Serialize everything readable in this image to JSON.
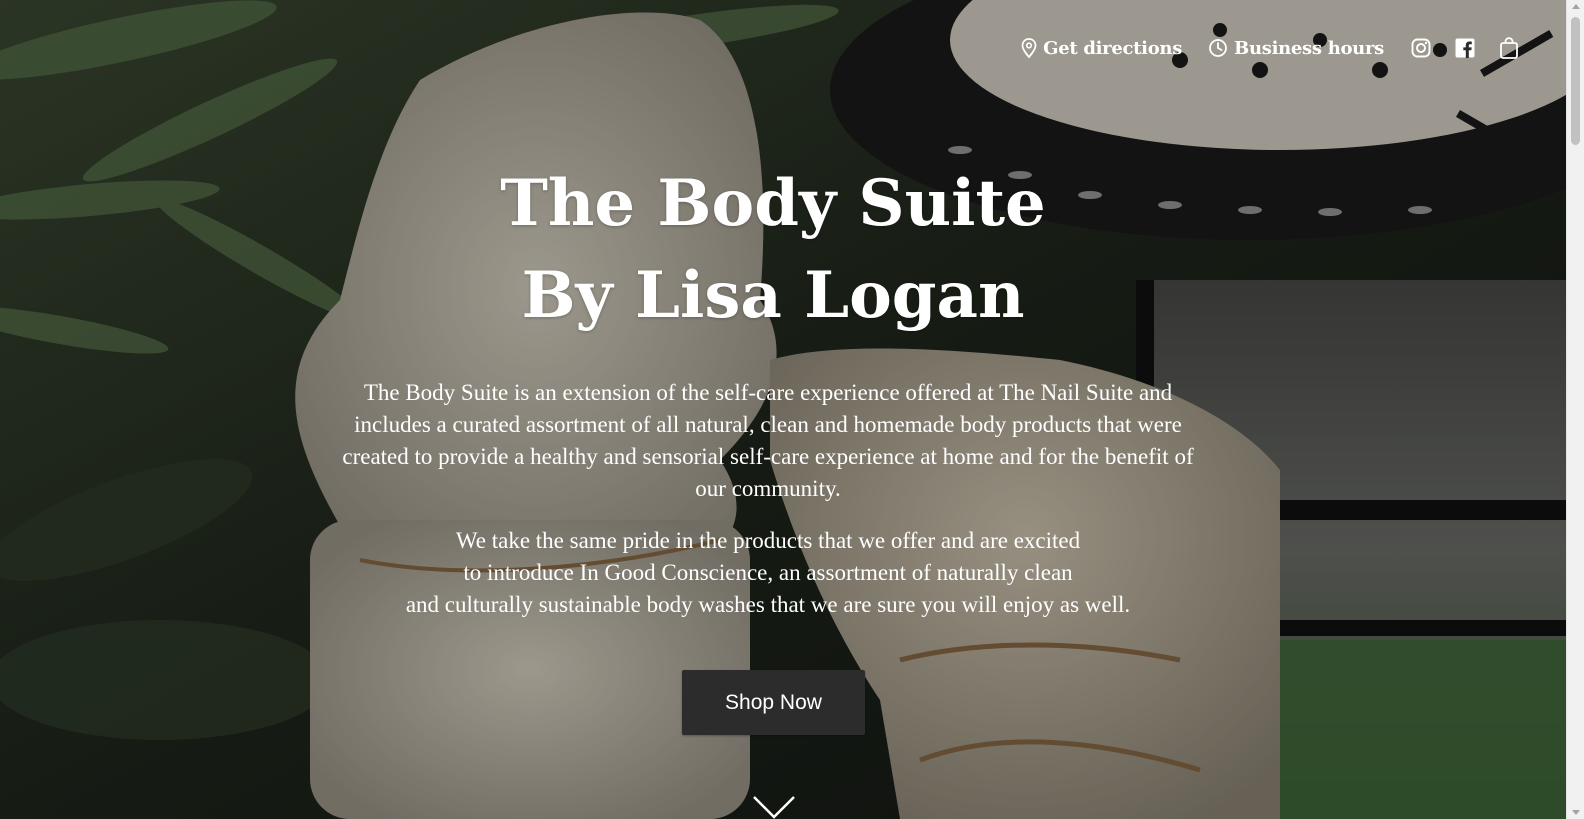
{
  "nav": {
    "directions_label": "Get directions",
    "hours_label": "Business hours",
    "icons": [
      "location-pin-icon",
      "clock-icon",
      "instagram-icon",
      "facebook-icon",
      "shopping-bag-icon"
    ]
  },
  "hero": {
    "title_line1": "The Body Suite",
    "title_line2": "By Lisa Logan",
    "paragraph1": "The Body Suite is an extension of the self-care experience offered at The Nail Suite and includes a curated assortment of all natural, clean and homemade body products that were created to provide a healthy and sensorial self-care experience at home and for the benefit of our community.",
    "paragraph2_lines": [
      "We take the same pride in the products that we offer and are excited",
      "to introduce In Good Conscience, an assortment of naturally clean",
      "and culturally sustainable body washes that we are sure you will enjoy as well."
    ],
    "cta_label": "Shop Now"
  },
  "colors": {
    "text": "#ffffff",
    "button_bg": "#2c2c2c",
    "overlay": "rgba(0,0,0,0.28)"
  }
}
